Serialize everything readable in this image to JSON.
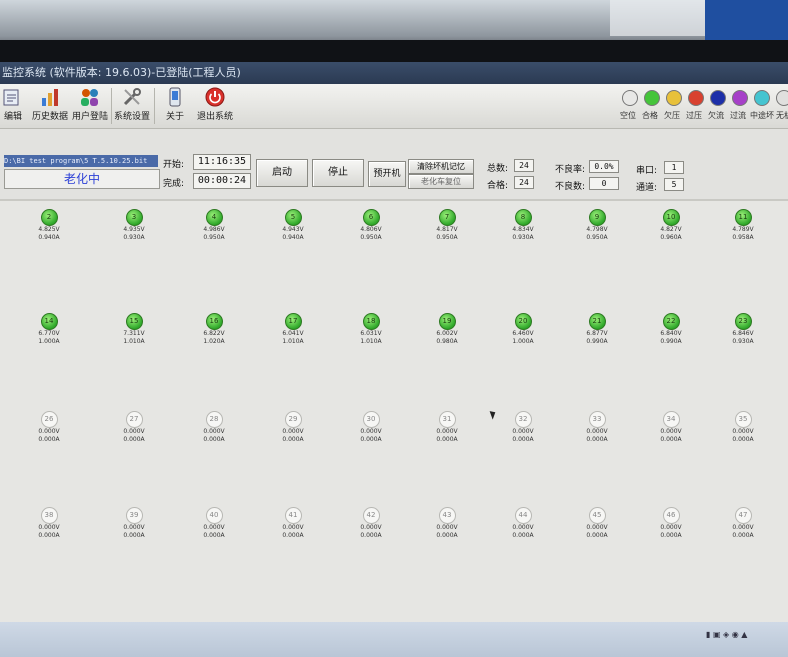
{
  "window": {
    "title": "监控系统 (软件版本: 19.6.03)-已登陆(工程人员)"
  },
  "toolbar": {
    "items": [
      {
        "label": "编辑",
        "icon": "edit-icon"
      },
      {
        "label": "历史数据",
        "icon": "history-data-icon"
      },
      {
        "label": "用户登陆",
        "icon": "user-login-icon"
      },
      {
        "label": "系统设置",
        "icon": "tools-icon"
      },
      {
        "label": "关于",
        "icon": "phone-info-icon"
      },
      {
        "label": "退出系统",
        "icon": "power-exit-icon"
      }
    ]
  },
  "legend": {
    "items": [
      {
        "label": "空位",
        "color": "#e8e8e6"
      },
      {
        "label": "合格",
        "color": "#45c43a"
      },
      {
        "label": "欠压",
        "color": "#e8c13a"
      },
      {
        "label": "过压",
        "color": "#d8412f"
      },
      {
        "label": "欠流",
        "color": "#1d2fa8"
      },
      {
        "label": "过流",
        "color": "#a640c8"
      },
      {
        "label": "中途坏",
        "color": "#45c4d0"
      },
      {
        "label": "无机",
        "color": "#e0e0de"
      }
    ]
  },
  "control": {
    "program_path": "D:\\BI test program\\5 T.5.10.25.bit",
    "status": "老化中",
    "start_label": "开始:",
    "start_time": "11:16:35",
    "done_label": "完成:",
    "done_time": "00:00:24",
    "btn_start": "启动",
    "btn_stop": "停止",
    "btn_preopen": "预开机",
    "btn_clear_memory": "清除坏机记忆",
    "btn_reset_cart": "老化车复位",
    "total_label": "总数:",
    "total_value": "24",
    "pass_label": "合格:",
    "pass_value": "24",
    "fail_rate_label": "不良率:",
    "fail_rate_value": "0.0%",
    "fail_label": "不良数:",
    "fail_value": "0",
    "port_label": "串口:",
    "port_value": "1",
    "channel_label": "通道:",
    "channel_value": "5"
  },
  "slots": [
    {
      "id": "2",
      "v": "4.825V",
      "a": "0.940A",
      "on": true
    },
    {
      "id": "3",
      "v": "4.935V",
      "a": "0.930A",
      "on": true
    },
    {
      "id": "4",
      "v": "4.986V",
      "a": "0.950A",
      "on": true
    },
    {
      "id": "5",
      "v": "4.943V",
      "a": "0.940A",
      "on": true
    },
    {
      "id": "6",
      "v": "4.806V",
      "a": "0.950A",
      "on": true
    },
    {
      "id": "7",
      "v": "4.817V",
      "a": "0.950A",
      "on": true
    },
    {
      "id": "8",
      "v": "4.834V",
      "a": "0.930A",
      "on": true
    },
    {
      "id": "9",
      "v": "4.798V",
      "a": "0.950A",
      "on": true
    },
    {
      "id": "10",
      "v": "4.827V",
      "a": "0.960A",
      "on": true
    },
    {
      "id": "11",
      "v": "4.789V",
      "a": "0.958A",
      "on": true
    },
    {
      "id": "14",
      "v": "6.770V",
      "a": "1.000A",
      "on": true
    },
    {
      "id": "15",
      "v": "7.311V",
      "a": "1.010A",
      "on": true
    },
    {
      "id": "16",
      "v": "6.822V",
      "a": "1.020A",
      "on": true
    },
    {
      "id": "17",
      "v": "6.041V",
      "a": "1.010A",
      "on": true
    },
    {
      "id": "18",
      "v": "6.031V",
      "a": "1.010A",
      "on": true
    },
    {
      "id": "19",
      "v": "6.002V",
      "a": "0.980A",
      "on": true
    },
    {
      "id": "20",
      "v": "6.460V",
      "a": "1.000A",
      "on": true
    },
    {
      "id": "21",
      "v": "6.877V",
      "a": "0.990A",
      "on": true
    },
    {
      "id": "22",
      "v": "6.840V",
      "a": "0.990A",
      "on": true
    },
    {
      "id": "23",
      "v": "6.846V",
      "a": "0.930A",
      "on": true
    },
    {
      "id": "26",
      "v": "0.000V",
      "a": "0.000A",
      "on": false
    },
    {
      "id": "27",
      "v": "0.000V",
      "a": "0.000A",
      "on": false
    },
    {
      "id": "28",
      "v": "0.000V",
      "a": "0.000A",
      "on": false
    },
    {
      "id": "29",
      "v": "0.000V",
      "a": "0.000A",
      "on": false
    },
    {
      "id": "30",
      "v": "0.000V",
      "a": "0.000A",
      "on": false
    },
    {
      "id": "31",
      "v": "0.000V",
      "a": "0.000A",
      "on": false
    },
    {
      "id": "32",
      "v": "0.000V",
      "a": "0.000A",
      "on": false
    },
    {
      "id": "33",
      "v": "0.000V",
      "a": "0.000A",
      "on": false
    },
    {
      "id": "34",
      "v": "0.000V",
      "a": "0.000A",
      "on": false
    },
    {
      "id": "35",
      "v": "0.000V",
      "a": "0.000A",
      "on": false
    },
    {
      "id": "38",
      "v": "0.000V",
      "a": "0.000A",
      "on": false
    },
    {
      "id": "39",
      "v": "0.000V",
      "a": "0.000A",
      "on": false
    },
    {
      "id": "40",
      "v": "0.000V",
      "a": "0.000A",
      "on": false
    },
    {
      "id": "41",
      "v": "0.000V",
      "a": "0.000A",
      "on": false
    },
    {
      "id": "42",
      "v": "0.000V",
      "a": "0.000A",
      "on": false
    },
    {
      "id": "43",
      "v": "0.000V",
      "a": "0.000A",
      "on": false
    },
    {
      "id": "44",
      "v": "0.000V",
      "a": "0.000A",
      "on": false
    },
    {
      "id": "45",
      "v": "0.000V",
      "a": "0.000A",
      "on": false
    },
    {
      "id": "46",
      "v": "0.000V",
      "a": "0.000A",
      "on": false
    },
    {
      "id": "47",
      "v": "0.000V",
      "a": "0.000A",
      "on": false
    }
  ]
}
